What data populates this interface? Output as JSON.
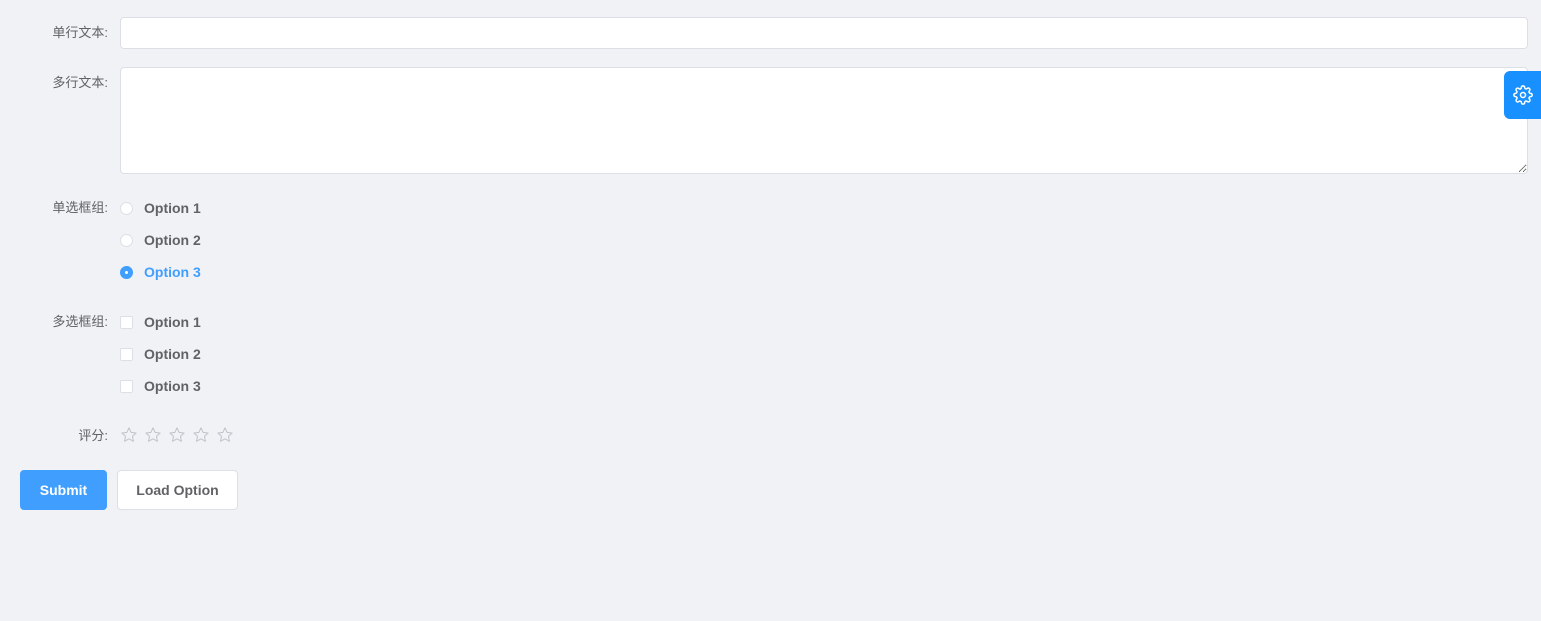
{
  "form": {
    "single_line": {
      "label": "单行文本:",
      "value": "",
      "placeholder": ""
    },
    "multi_line": {
      "label": "多行文本:",
      "value": "",
      "placeholder": ""
    },
    "radio_group": {
      "label": "单选框组:",
      "options": [
        "Option 1",
        "Option 2",
        "Option 3"
      ],
      "selected": "Option 3"
    },
    "checkbox_group": {
      "label": "多选框组:",
      "options": [
        "Option 1",
        "Option 2",
        "Option 3"
      ],
      "checked": []
    },
    "rating": {
      "label": "评分:",
      "max": 5,
      "value": 0
    }
  },
  "actions": {
    "submit_label": "Submit",
    "load_option_label": "Load Option"
  },
  "icons": {
    "settings": "gear-icon",
    "star": "star-outline-icon"
  },
  "colors": {
    "primary": "#409eff",
    "settings_tab": "#1890ff",
    "background": "#f0f2f5",
    "border": "#dcdfe6",
    "text": "#606266"
  }
}
